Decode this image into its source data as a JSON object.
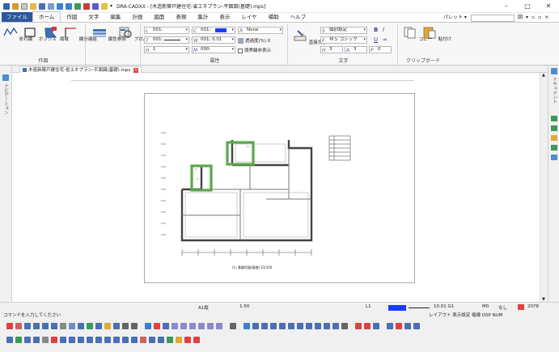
{
  "window": {
    "title": "DRA-CADXX - [木造新築戸建住宅-省エネプラン-平面図(基礎).mps]",
    "controls": [
      "–",
      "□",
      "✕"
    ]
  },
  "ribbon_tabs": [
    "ファイル",
    "ホーム",
    "作図",
    "文字",
    "編集",
    "計画",
    "図面",
    "表現",
    "集計",
    "表示",
    "レイヤ",
    "補助",
    "ヘルプ"
  ],
  "palette_label": "パレット ▾",
  "tab_right": [
    "図",
    "▾",
    "▫",
    "▫",
    "×"
  ],
  "groups": {
    "draw": {
      "label": "作図",
      "buttons": [
        "折れ線",
        "ボックス",
        "領域",
        "線分連結"
      ]
    },
    "attr_ref": [
      "属性参照",
      "プロパティ"
    ],
    "attributes": {
      "label": "属性",
      "layer": "001:",
      "color": "001:",
      "line_type": "001:",
      "line_width": "001: 0.01",
      "hatch": "1",
      "font_sz": "000:",
      "render": "None",
      "transparency": "透過度(%) 0",
      "show_boundary": "境界線非表示"
    },
    "text": {
      "label": "文字",
      "direct": "直接文字",
      "preset": "個別設定",
      "font": "ＭＳ ゴシック",
      "size_a": "3",
      "size_b": "3",
      "spacing": "0"
    },
    "clipboard": {
      "label": "クリップボード",
      "copy": "コピー",
      "paste": "貼付け"
    }
  },
  "document_tab": "木造新築戸建住宅-省エネプラン-平面図(基礎).mps",
  "left_pane_label": "ナビゲーション",
  "right_pane_label": "ドキュメント",
  "drawing": {
    "caption": "(1) 基礎伏図(基礎)  S1/100"
  },
  "status": {
    "prompt": "コマンドを入力してください",
    "paper": "A1縦",
    "scale": "1:50",
    "layer": "L1",
    "line": "10.01 G1",
    "mode": "M0",
    "snap": "なし",
    "count": "2078",
    "right_labels": "レイアウト   表示設定 電線 OSP NUM"
  }
}
